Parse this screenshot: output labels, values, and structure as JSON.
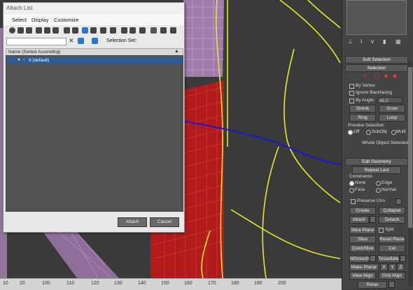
{
  "dialog": {
    "title": "Attach List",
    "menu": [
      "Select",
      "Display",
      "Customize"
    ],
    "selection_set_label": "Selection Set:",
    "list_header": "Name (Sorted Ascending)",
    "items": [
      "0 (default)"
    ],
    "attach_button": "Attach",
    "cancel_button": "Cancel"
  },
  "ruler": {
    "ticks": [
      "10",
      "20",
      "100",
      "110",
      "120",
      "130",
      "140",
      "150",
      "160",
      "170",
      "180",
      "190",
      "200"
    ]
  },
  "panel": {
    "soft_selection": "Soft Selection",
    "selection": "Selection",
    "by_vertex": "By Vertex",
    "ignore_backfacing": "Ignore Backfacing",
    "by_angle": "By Angle:",
    "by_angle_value": "45.0",
    "shrink": "Shrink",
    "grow": "Grow",
    "ring": "Ring",
    "loop": "Loop",
    "preview_selection": "Preview Selection",
    "preview_off": "Off",
    "preview_subobj": "SubObj",
    "preview_multi": "Multi",
    "whole_object_selected": "Whole Object Selected",
    "edit_geometry": "Edit Geometry",
    "repeat_last": "Repeat Last",
    "constraints": "Constraints",
    "none": "None",
    "edge": "Edge",
    "face": "Face",
    "normal": "Normal",
    "preserve_uvs": "Preserve UVs",
    "create": "Create",
    "collapse": "Collapse",
    "attach": "Attach",
    "detach": "Detach",
    "slice_plane": "Slice Plane",
    "split": "Split",
    "slice": "Slice",
    "reset_plane": "Reset Plane",
    "quickslice": "QuickSlice",
    "cut": "Cut",
    "msmooth": "MSmooth",
    "tessellate": "Tessellate",
    "make_planar": "Make Planar",
    "x": "X",
    "y": "Y",
    "z": "Z",
    "view_align": "View Align",
    "grid_align": "Grid Align",
    "relax": "Relax"
  },
  "colors": {
    "annotation": "#1a1acc",
    "wire_yellow": "#e8e82a",
    "wire_red": "#d31a1a",
    "wire_pink": "#c987d8",
    "selection_blue": "#2f5d93"
  }
}
